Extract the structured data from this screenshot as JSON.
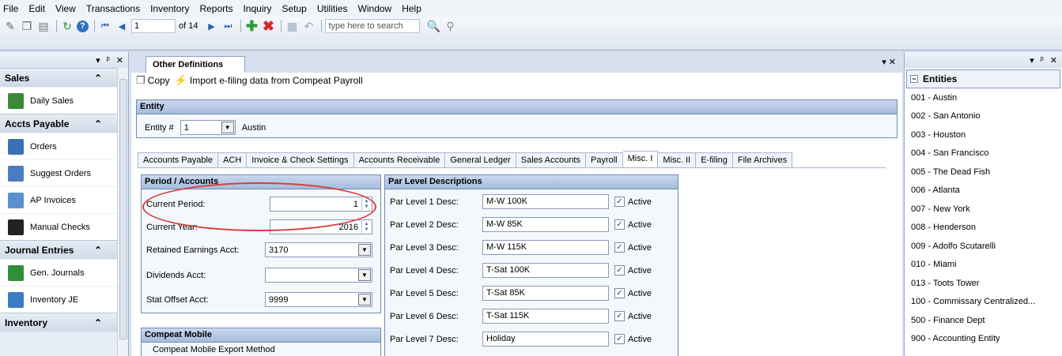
{
  "menu": [
    "File",
    "Edit",
    "View",
    "Transactions",
    "Inventory",
    "Reports",
    "Inquiry",
    "Setup",
    "Utilities",
    "Window",
    "Help"
  ],
  "toolbar": {
    "page_value": "1",
    "page_of": "of 14",
    "search_placeholder": "type here to search"
  },
  "left_panel": {
    "header_controls": [
      "▾",
      "ᵖ",
      "✕"
    ],
    "sections": [
      {
        "title": "Sales",
        "items": [
          {
            "label": "Daily Sales",
            "color": "#3a8a3a"
          }
        ]
      },
      {
        "title": "Accts Payable",
        "items": [
          {
            "label": "Orders",
            "color": "#3b6fb6"
          },
          {
            "label": "Suggest Orders",
            "color": "#4a7cc0"
          },
          {
            "label": "AP Invoices",
            "color": "#5b8fd0"
          },
          {
            "label": "Manual Checks",
            "color": "#222222"
          }
        ]
      },
      {
        "title": "Journal Entries",
        "items": [
          {
            "label": "Gen. Journals",
            "color": "#2f8f3a"
          },
          {
            "label": "Inventory JE",
            "color": "#3a7cc4"
          }
        ]
      },
      {
        "title": "Inventory",
        "items": []
      }
    ]
  },
  "main": {
    "doc_tab": "Other Definitions",
    "actions": {
      "copy": "Copy",
      "import": "Import e-filing data from Compeat Payroll"
    },
    "entity": {
      "header": "Entity",
      "label": "Entity #",
      "value": "1",
      "name": "Austin"
    },
    "tabs": [
      "Accounts Payable",
      "ACH",
      "Invoice & Check Settings",
      "Accounts Receivable",
      "General Ledger",
      "Sales Accounts",
      "Payroll",
      "Misc. I",
      "Misc. II",
      "E-filing",
      "File Archives"
    ],
    "active_tab": "Misc. I",
    "period": {
      "header": "Period / Accounts",
      "current_period_label": "Current Period:",
      "current_period": "1",
      "current_year_label": "Current Year:",
      "current_year": "2016",
      "retained_label": "Retained Earnings Acct:",
      "retained": "3170",
      "dividends_label": "Dividends Acct:",
      "dividends": "",
      "stat_offset_label": "Stat Offset Acct:",
      "stat_offset": "9999"
    },
    "mobile": {
      "header": "Compeat Mobile",
      "export_method": "Compeat Mobile Export Method"
    },
    "par_levels": {
      "header": "Par Level Descriptions",
      "active_label": "Active",
      "rows": [
        {
          "label": "Par Level 1 Desc:",
          "value": "M-W 100K",
          "active": true
        },
        {
          "label": "Par Level 2 Desc:",
          "value": "M-W 85K",
          "active": true
        },
        {
          "label": "Par Level 3 Desc:",
          "value": "M-W 115K",
          "active": true
        },
        {
          "label": "Par Level 4 Desc:",
          "value": "T-Sat 100K",
          "active": true
        },
        {
          "label": "Par Level 5 Desc:",
          "value": "T-Sat 85K",
          "active": true
        },
        {
          "label": "Par Level 6 Desc:",
          "value": "T-Sat 115K",
          "active": true
        },
        {
          "label": "Par Level 7 Desc:",
          "value": "Holiday",
          "active": true
        }
      ]
    }
  },
  "right_panel": {
    "title": "Entities",
    "items": [
      "001 - Austin",
      "002 - San Antonio",
      "003 - Houston",
      "004 - San Francisco",
      "005 - The Dead Fish",
      "006 - Atlanta",
      "007 - New York",
      "008 - Henderson",
      "009 - Adolfo Scutarelli",
      "010 - Miami",
      "013 - Toots Tower",
      "100 - Commissary Centralized...",
      "500 - Finance Dept",
      "900 - Accounting Entity"
    ]
  }
}
